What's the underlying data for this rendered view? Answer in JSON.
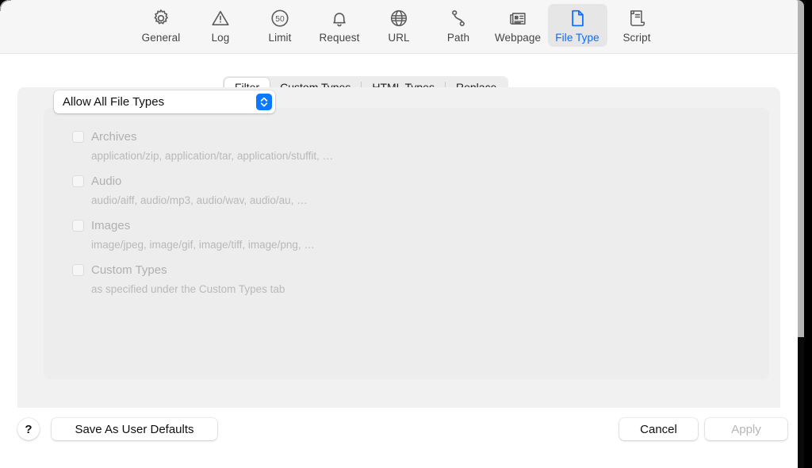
{
  "toolbar": {
    "items": [
      {
        "label": "General",
        "icon": "gear-icon",
        "selected": false
      },
      {
        "label": "Log",
        "icon": "warning-icon",
        "selected": false
      },
      {
        "label": "Limit",
        "icon": "speed-50-icon",
        "selected": false
      },
      {
        "label": "Request",
        "icon": "bell-icon",
        "selected": false
      },
      {
        "label": "URL",
        "icon": "globe-icon",
        "selected": false
      },
      {
        "label": "Path",
        "icon": "path-icon",
        "selected": false
      },
      {
        "label": "Webpage",
        "icon": "webpage-icon",
        "selected": false
      },
      {
        "label": "File Type",
        "icon": "document-icon",
        "selected": true
      },
      {
        "label": "Script",
        "icon": "script-icon",
        "selected": false
      }
    ],
    "limit_icon_number": "50"
  },
  "tabs": {
    "items": [
      {
        "label": "Filter",
        "selected": true
      },
      {
        "label": "Custom Types",
        "selected": false
      },
      {
        "label": "HTML Types",
        "selected": false
      },
      {
        "label": "Replace",
        "selected": false
      }
    ]
  },
  "filter": {
    "popup": {
      "value": "Allow All File Types",
      "indicator_icon": "chevron-up-down-icon"
    },
    "rows": [
      {
        "label": "Archives",
        "description": "application/zip, application/tar, application/stuffit, …",
        "checked": false,
        "enabled": false
      },
      {
        "label": "Audio",
        "description": "audio/aiff, audio/mp3, audio/wav, audio/au, …",
        "checked": false,
        "enabled": false
      },
      {
        "label": "Images",
        "description": "image/jpeg, image/gif, image/tiff, image/png, …",
        "checked": false,
        "enabled": false
      },
      {
        "label": "Custom Types",
        "description": "as specified under the Custom Types tab",
        "checked": false,
        "enabled": false
      }
    ]
  },
  "footer": {
    "help_label": "?",
    "save_defaults_label": "Save As User Defaults",
    "cancel_label": "Cancel",
    "apply_label": "Apply",
    "apply_enabled": false
  },
  "colors": {
    "accent": "#0a6cff",
    "popup_indicator": "#0a78ff",
    "toolbar_bg": "#f6f6f6",
    "panel_outer": "#f1f1f1",
    "panel_inner": "#ededed",
    "disabled_text": "#b0b0b3"
  }
}
